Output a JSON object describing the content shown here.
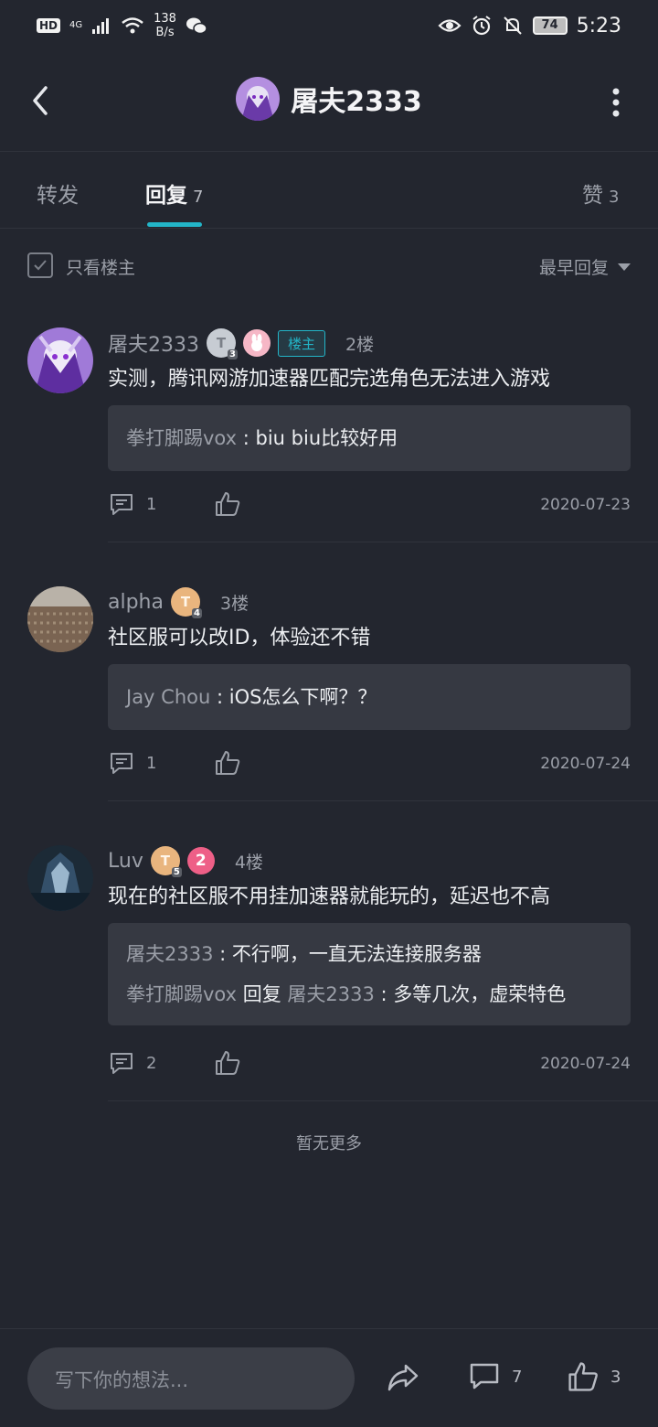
{
  "status_bar": {
    "hd": "HD",
    "network": "4G",
    "rate": "138",
    "rate_unit": "B/s",
    "battery": "74",
    "time": "5:23"
  },
  "header": {
    "title": "屠夫2333"
  },
  "tabs": [
    {
      "label": "转发",
      "count": ""
    },
    {
      "label": "回复",
      "count": "7"
    },
    {
      "label": "赞",
      "count": "3"
    }
  ],
  "filter": {
    "only_owner_label": "只看楼主",
    "sort_label": "最早回复"
  },
  "posts": [
    {
      "username": "屠夫2333",
      "badge_level": "T",
      "badge_sub": "3",
      "owner_tag": "楼主",
      "floor": "2楼",
      "content": "实测，腾讯网游加速器匹配完选角色无法进入游戏",
      "quotes": [
        {
          "user": "拳打脚踢vox",
          "sep": " : ",
          "text": "biu biu比较好用"
        }
      ],
      "comment_count": "1",
      "date": "2020-07-23"
    },
    {
      "username": "alpha",
      "badge_level": "T",
      "badge_sub": "4",
      "floor": "3楼",
      "content": "社区服可以改ID，体验还不错",
      "quotes": [
        {
          "user": "Jay Chou",
          "sep": " : ",
          "text": "iOS怎么下啊？？"
        }
      ],
      "comment_count": "1",
      "date": "2020-07-24"
    },
    {
      "username": "Luv",
      "badge_level": "T",
      "badge_sub": "5",
      "badge_num": "2",
      "floor": "4楼",
      "content": "现在的社区服不用挂加速器就能玩的，延迟也不高",
      "quotes": [
        {
          "user": "屠夫2333",
          "sep": " : ",
          "text": "不行啊，一直无法连接服务器"
        },
        {
          "user": "拳打脚踢vox",
          "mid": " 回复 ",
          "user2": "屠夫2333",
          "sep": " : ",
          "text": "多等几次，虚荣特色"
        }
      ],
      "comment_count": "2",
      "date": "2020-07-24"
    }
  ],
  "no_more": "暂无更多",
  "bottom": {
    "placeholder": "写下你的想法...",
    "comment_count": "7",
    "like_count": "3"
  },
  "colors": {
    "background": "#23262f",
    "accent": "#23b5c8"
  }
}
